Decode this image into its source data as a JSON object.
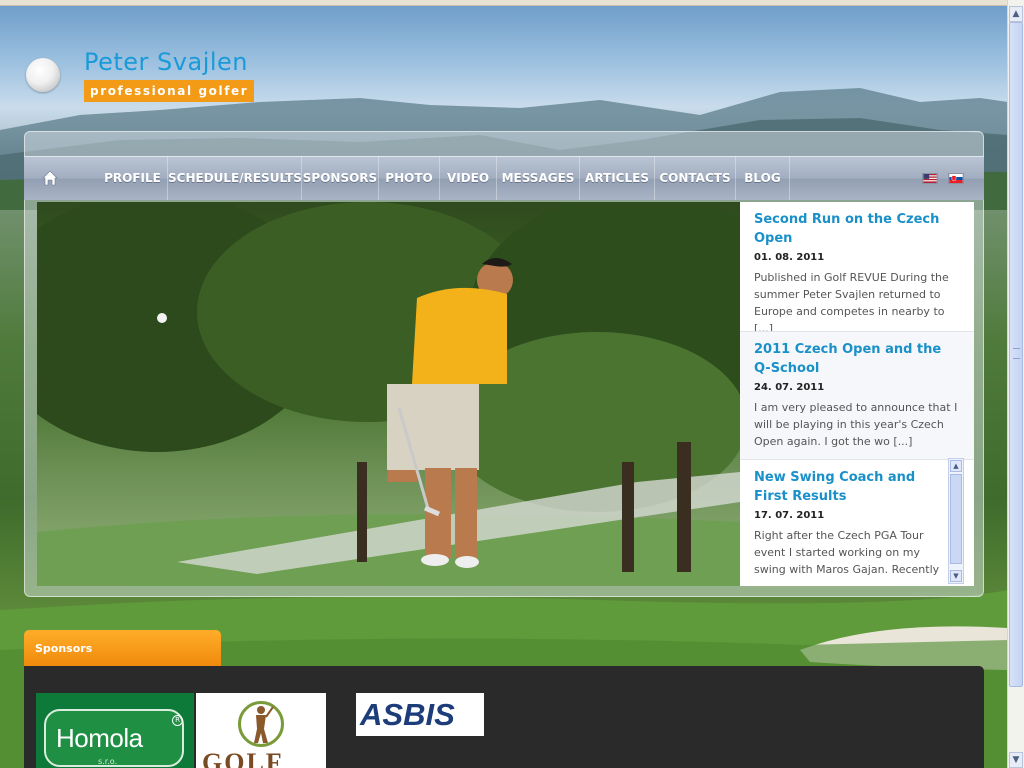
{
  "site": {
    "name": "Peter Svajlen",
    "tagline": "professional golfer"
  },
  "nav": {
    "items": [
      "PROFILE",
      "SCHEDULE/RESULTS",
      "SPONSORS",
      "PHOTO",
      "VIDEO",
      "MESSAGES",
      "ARTICLES",
      "CONTACTS",
      "BLOG"
    ],
    "languages": [
      "english-flag",
      "slovak-flag"
    ]
  },
  "news": [
    {
      "title": "Second Run on the Czech Open",
      "date": "01. 08. 2011",
      "excerpt": "Published in Golf REVUE During the summer Peter Svajlen returned to Europe and competes in nearby to [...]"
    },
    {
      "title": "2011 Czech Open and the Q-School",
      "date": "24. 07. 2011",
      "excerpt": "I am very pleased to announce that I will be playing in this year's Czech Open again. I got the wo [...]"
    },
    {
      "title": "New Swing Coach and First Results",
      "date": "17. 07. 2011",
      "excerpt": "Right after the Czech PGA Tour event I started working on my swing with Maros Gajan. Recently"
    }
  ],
  "sponsors": {
    "heading": "Sponsors",
    "logos": {
      "homola": "Homola",
      "homola_sub": "s.r.o.",
      "golf": "GOLF",
      "asbis": "ASBIS"
    }
  },
  "colors": {
    "accent": "#1a9ad8",
    "orange": "#f39a16",
    "nav": "#a3afc1"
  }
}
